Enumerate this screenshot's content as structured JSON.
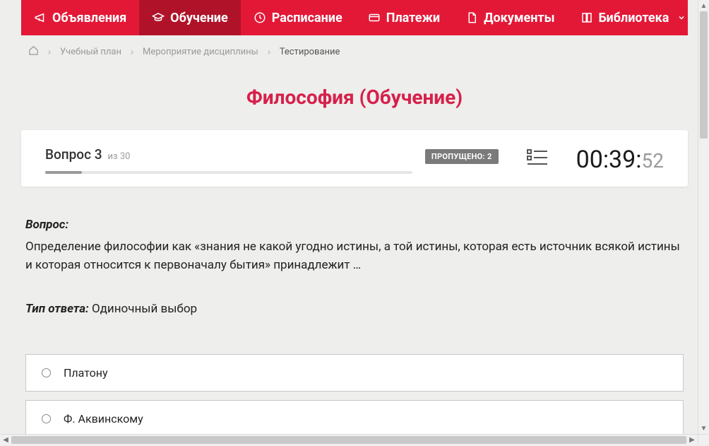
{
  "nav": {
    "items": [
      {
        "label": "Объявления",
        "icon": "megaphone-icon",
        "active": false
      },
      {
        "label": "Обучение",
        "icon": "graduation-cap-icon",
        "active": true
      },
      {
        "label": "Расписание",
        "icon": "clock-icon",
        "active": false
      },
      {
        "label": "Платежи",
        "icon": "card-icon",
        "active": false
      },
      {
        "label": "Документы",
        "icon": "document-icon",
        "active": false
      },
      {
        "label": "Библиотека",
        "icon": "book-icon",
        "active": false,
        "dropdown": true
      }
    ]
  },
  "breadcrumb": {
    "items": [
      {
        "label": "Учебный план"
      },
      {
        "label": "Мероприятие дисциплины"
      }
    ],
    "current": "Тестирование"
  },
  "page": {
    "title": "Философия (Обучение)"
  },
  "status": {
    "question_label": "Вопрос 3",
    "of_label": "из 30",
    "skipped_label": "ПРОПУЩЕНО: 2",
    "progress_percent": 10,
    "timer_main": "00:39:",
    "timer_seconds": "52"
  },
  "question": {
    "heading": "Вопрос:",
    "text": "Определение философии как «знания не какой угодно истины, а той истины, которая есть источник всякой истины и которая относится к первоначалу бытия» принадлежит …",
    "answer_type_label": "Тип ответа:",
    "answer_type_value": "Одиночный выбор"
  },
  "options": [
    {
      "label": "Платону"
    },
    {
      "label": "Ф. Аквинскому"
    }
  ]
}
